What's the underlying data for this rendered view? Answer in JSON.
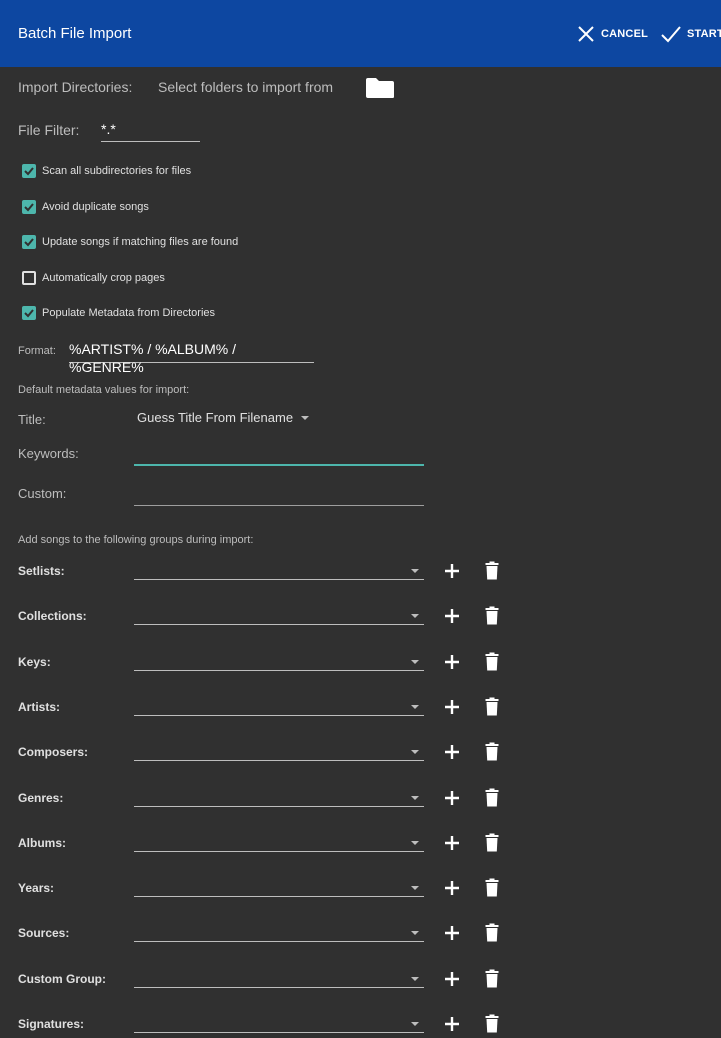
{
  "appbar": {
    "title": "Batch File Import",
    "cancel_label": "CANCEL",
    "start_label": "START",
    "cancel_icon": "close-icon",
    "start_icon": "check-icon",
    "color": "#0d47a1"
  },
  "import": {
    "directories_label": "Import Directories:",
    "directories_hint": "Select folders to import from",
    "folder_icon": "folder-icon",
    "filter_label": "File Filter:",
    "filter_value": "*.*"
  },
  "options": [
    {
      "label": "Scan all subdirectories for files",
      "checked": true
    },
    {
      "label": "Avoid duplicate songs",
      "checked": true
    },
    {
      "label": "Update songs if matching files are found",
      "checked": true
    },
    {
      "label": "Automatically crop pages",
      "checked": false
    },
    {
      "label": "Populate Metadata from Directories",
      "checked": true
    }
  ],
  "format": {
    "label": "Format:",
    "value": "%ARTIST% / %ALBUM% / %GENRE%"
  },
  "metadata": {
    "heading": "Default metadata values for import:",
    "title_label": "Title:",
    "title_value": "Guess Title From Filename",
    "keywords_label": "Keywords:",
    "keywords_value": "",
    "custom_label": "Custom:",
    "custom_value": ""
  },
  "groups": {
    "heading": "Add songs to the following groups during import:",
    "items": [
      {
        "label": "Setlists:"
      },
      {
        "label": "Collections:"
      },
      {
        "label": "Keys:"
      },
      {
        "label": "Artists:"
      },
      {
        "label": "Composers:"
      },
      {
        "label": "Genres:"
      },
      {
        "label": "Albums:"
      },
      {
        "label": "Years:"
      },
      {
        "label": "Sources:"
      },
      {
        "label": "Custom Group:"
      },
      {
        "label": "Signatures:"
      }
    ]
  },
  "accent": "#4db6ac"
}
